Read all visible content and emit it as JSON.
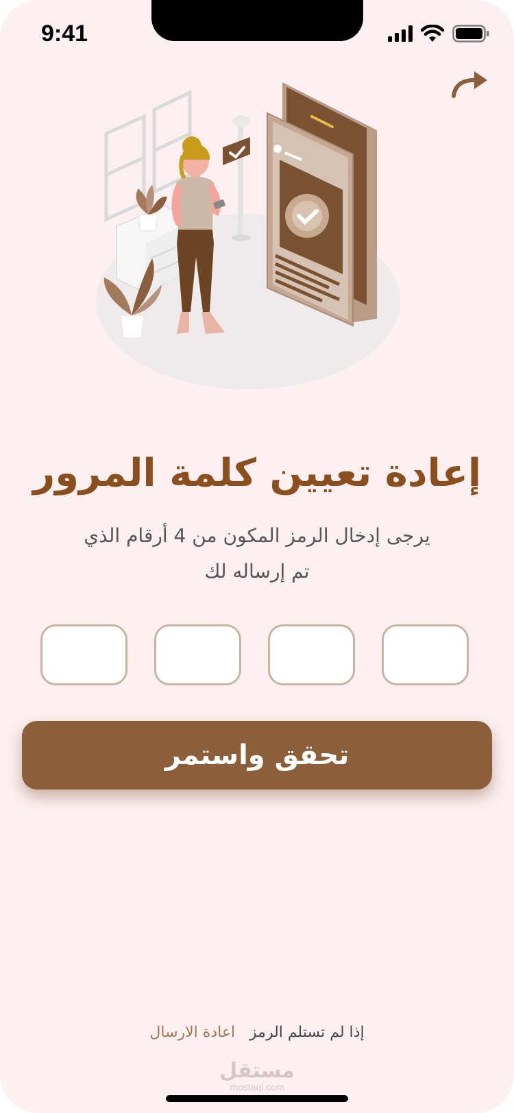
{
  "status_bar": {
    "time": "9:41"
  },
  "icons": {
    "signal": "cellular-signal-icon",
    "wifi": "wifi-icon",
    "battery": "battery-icon",
    "forward": "forward-arrow-icon"
  },
  "header": {
    "title": "إعادة تعيين كلمة المرور",
    "subtitle_line1": "يرجى إدخال الرمز المكون من 4 أرقام الذي",
    "subtitle_line2": "تم إرساله لك"
  },
  "code_inputs": [
    {
      "value": ""
    },
    {
      "value": ""
    },
    {
      "value": ""
    },
    {
      "value": ""
    }
  ],
  "verify_button": {
    "label": "تحقق واستمر"
  },
  "footer": {
    "prompt": "إذا لم تستلم الرمز",
    "resend_label": "اعادة الارسال"
  },
  "watermark": {
    "main": "مستقل",
    "sub": "mostaqi.com"
  },
  "colors": {
    "background": "#fcf0f3",
    "accent": "#8c5e3a",
    "title": "#8b4f1e",
    "input_border": "#c8b49f",
    "link": "#a07850"
  }
}
